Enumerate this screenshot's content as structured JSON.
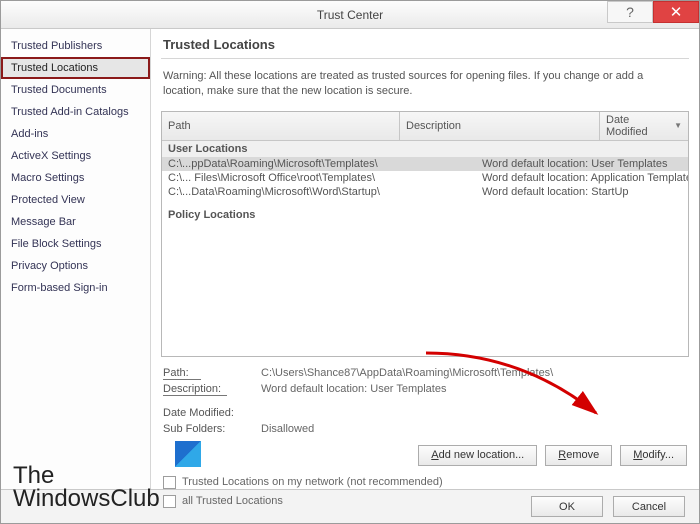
{
  "window": {
    "title": "Trust Center"
  },
  "sidebar": {
    "items": [
      {
        "label": "Trusted Publishers"
      },
      {
        "label": "Trusted Locations"
      },
      {
        "label": "Trusted Documents"
      },
      {
        "label": "Trusted Add-in Catalogs"
      },
      {
        "label": "Add-ins"
      },
      {
        "label": "ActiveX Settings"
      },
      {
        "label": "Macro Settings"
      },
      {
        "label": "Protected View"
      },
      {
        "label": "Message Bar"
      },
      {
        "label": "File Block Settings"
      },
      {
        "label": "Privacy Options"
      },
      {
        "label": "Form-based Sign-in"
      }
    ],
    "selected_index": 1
  },
  "section": {
    "title": "Trusted Locations"
  },
  "warning": "Warning: All these locations are treated as trusted sources for opening files. If you change or add a location, make sure that the new location is secure.",
  "grid": {
    "headers": {
      "path": "Path",
      "desc": "Description",
      "date": "Date Modified"
    },
    "groups": {
      "user": "User Locations",
      "policy": "Policy Locations"
    },
    "rows": [
      {
        "path": "C:\\...ppData\\Roaming\\Microsoft\\Templates\\",
        "desc": "Word default location: User Templates",
        "selected": true
      },
      {
        "path": "C:\\... Files\\Microsoft Office\\root\\Templates\\",
        "desc": "Word default location: Application Templates",
        "selected": false
      },
      {
        "path": "C:\\...Data\\Roaming\\Microsoft\\Word\\Startup\\",
        "desc": "Word default location: StartUp",
        "selected": false
      }
    ]
  },
  "details": {
    "path_label": "Path:",
    "path_value": "C:\\Users\\Shance87\\AppData\\Roaming\\Microsoft\\Templates\\",
    "desc_label": "Description:",
    "desc_value": "Word default location: User Templates",
    "date_label": "Date Modified:",
    "date_value": "",
    "sub_label": "Sub Folders:",
    "sub_value": "Disallowed"
  },
  "buttons": {
    "add": "Add new location...",
    "remove": "Remove",
    "modify": "Modify..."
  },
  "checks": {
    "network": "Trusted Locations on my network (not recommended)",
    "disable": "all Trusted Locations"
  },
  "footer": {
    "ok": "OK",
    "cancel": "Cancel"
  },
  "watermark": {
    "line1": "The",
    "line2": "WindowsClub"
  }
}
